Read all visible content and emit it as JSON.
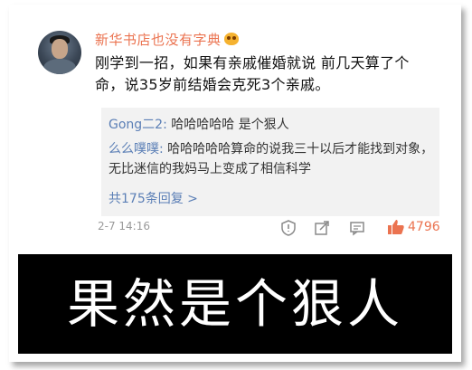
{
  "post": {
    "username": "新华书店也没有字典",
    "comment_line1": "刚学到一招，如果有亲戚催婚就说  前几天算了个",
    "comment_line2": "命，说35岁前结婚会克死3个亲戚。",
    "timestamp": "2-7 14:16",
    "like_count": "4796"
  },
  "replies": [
    {
      "user": "Gong二2:",
      "text": " 哈哈哈哈哈 是个狠人"
    },
    {
      "user": "么么噗噗:",
      "text": " 哈哈哈哈哈算命的说我三十以后才能找到对象，无比迷信的我妈马上变成了相信科学"
    }
  ],
  "more_replies": "共175条回复 >",
  "caption": "果然是个狠人",
  "colors": {
    "username": "#eb7350",
    "reply_user": "#5b7fb6",
    "like": "#eb7350"
  },
  "icons": [
    "verified-badge-icon",
    "report-icon",
    "share-icon",
    "comment-icon",
    "thumbs-up-icon"
  ]
}
